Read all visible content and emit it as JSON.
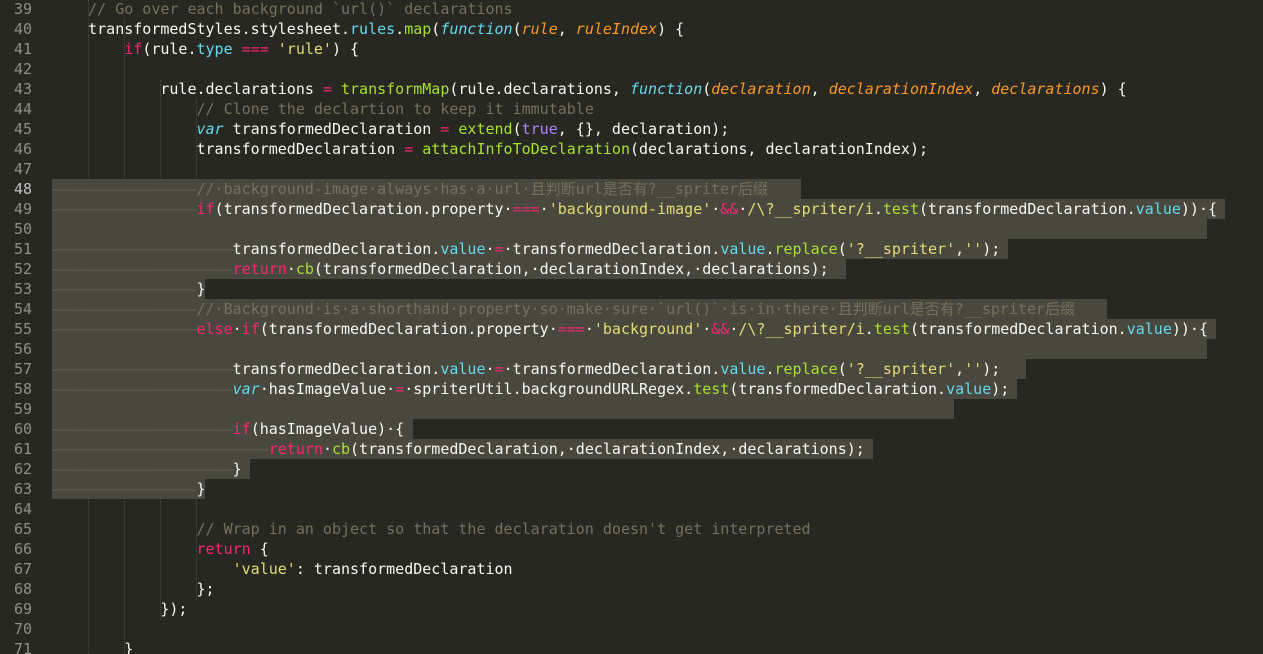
{
  "editor": {
    "theme": "monokai",
    "colors": {
      "background": "#272822",
      "selection": "#49483e",
      "keyword": "#f92672",
      "string": "#e6db74",
      "comment": "#75715e",
      "function": "#a6e22e",
      "property": "#66d9ef",
      "constant": "#ae81ff",
      "param": "#fd971f"
    },
    "line_numbers": [
      "39",
      "40",
      "41",
      "42",
      "43",
      "44",
      "45",
      "46",
      "47",
      "48",
      "49",
      "50",
      "51",
      "52",
      "53",
      "54",
      "55",
      "56",
      "57",
      "58",
      "59",
      "60",
      "61",
      "62",
      "63",
      "64",
      "65",
      "66",
      "67",
      "68",
      "69",
      "70",
      "71"
    ],
    "active_line": "48",
    "lines": [
      [
        [
          "c",
          "    // Go over each background `url()` declarations"
        ]
      ],
      [
        [
          "plain",
          "    transformedStyles.stylesheet."
        ],
        [
          "p",
          "rules"
        ],
        [
          "plain",
          "."
        ],
        [
          "f",
          "map"
        ],
        [
          "plain",
          "("
        ],
        [
          "i",
          "function"
        ],
        [
          "plain",
          "("
        ],
        [
          "t",
          "rule"
        ],
        [
          "plain",
          ", "
        ],
        [
          "t",
          "ruleIndex"
        ],
        [
          "plain",
          ") {"
        ]
      ],
      [
        [
          "plain",
          "        "
        ],
        [
          "k",
          "if"
        ],
        [
          "plain",
          "(rule."
        ],
        [
          "p",
          "type"
        ],
        [
          "plain",
          " "
        ],
        [
          "k",
          "==="
        ],
        [
          "plain",
          " "
        ],
        [
          "s",
          "'rule'"
        ],
        [
          "plain",
          ") {"
        ]
      ],
      [
        [
          "plain",
          ""
        ]
      ],
      [
        [
          "plain",
          "            rule.declarations "
        ],
        [
          "k",
          "="
        ],
        [
          "plain",
          " "
        ],
        [
          "f",
          "transformMap"
        ],
        [
          "plain",
          "(rule.declarations, "
        ],
        [
          "i",
          "function"
        ],
        [
          "plain",
          "("
        ],
        [
          "t",
          "declaration"
        ],
        [
          "plain",
          ", "
        ],
        [
          "t",
          "declarationIndex"
        ],
        [
          "plain",
          ", "
        ],
        [
          "t",
          "declarations"
        ],
        [
          "plain",
          ") {"
        ]
      ],
      [
        [
          "plain",
          "                "
        ],
        [
          "c",
          "// Clone the declartion to keep it immutable"
        ]
      ],
      [
        [
          "plain",
          "                "
        ],
        [
          "i",
          "var"
        ],
        [
          "plain",
          " transformedDeclaration "
        ],
        [
          "k",
          "="
        ],
        [
          "plain",
          " "
        ],
        [
          "f",
          "extend"
        ],
        [
          "plain",
          "("
        ],
        [
          "n",
          "true"
        ],
        [
          "plain",
          ", {}, declaration);"
        ]
      ],
      [
        [
          "plain",
          "                transformedDeclaration "
        ],
        [
          "k",
          "="
        ],
        [
          "plain",
          " "
        ],
        [
          "f",
          "attachInfoToDeclaration"
        ],
        [
          "plain",
          "(declarations, declarationIndex);"
        ]
      ],
      [
        [
          "plain",
          ""
        ]
      ],
      [
        [
          "ws",
          "————————————————"
        ],
        [
          "c",
          "//·background-image·always·has·a·url·且判断url是否有?__spriter后缀"
        ]
      ],
      [
        [
          "ws",
          "————————————————"
        ],
        [
          "k",
          "if"
        ],
        [
          "plain",
          "(transformedDeclaration.property·"
        ],
        [
          "k",
          "==="
        ],
        [
          "plain",
          "·"
        ],
        [
          "s",
          "'background-image'"
        ],
        [
          "plain",
          "·"
        ],
        [
          "k",
          "&&"
        ],
        [
          "plain",
          "·"
        ],
        [
          "s",
          "/\\?__spriter/i"
        ],
        [
          "plain",
          "."
        ],
        [
          "f",
          "test"
        ],
        [
          "plain",
          "(transformedDeclaration."
        ],
        [
          "p",
          "value"
        ],
        [
          "plain",
          "))·{"
        ]
      ],
      [
        [
          "plain",
          ""
        ]
      ],
      [
        [
          "ws",
          "————————————————————"
        ],
        [
          "plain",
          "transformedDeclaration."
        ],
        [
          "p",
          "value"
        ],
        [
          "plain",
          "·"
        ],
        [
          "k",
          "="
        ],
        [
          "plain",
          "·transformedDeclaration."
        ],
        [
          "p",
          "value"
        ],
        [
          "plain",
          "."
        ],
        [
          "f",
          "replace"
        ],
        [
          "plain",
          "("
        ],
        [
          "s",
          "'?__spriter'"
        ],
        [
          "plain",
          ","
        ],
        [
          "s",
          "''"
        ],
        [
          "plain",
          ");"
        ]
      ],
      [
        [
          "ws",
          "————————————————————"
        ],
        [
          "k",
          "return"
        ],
        [
          "plain",
          "·"
        ],
        [
          "f",
          "cb"
        ],
        [
          "plain",
          "(transformedDeclaration,·declarationIndex,·declarations);"
        ]
      ],
      [
        [
          "ws",
          "————————————————"
        ],
        [
          "plain",
          "}"
        ]
      ],
      [
        [
          "ws",
          "————————————————"
        ],
        [
          "c",
          "//·Background·is·a·shorthand·property·so·make·sure·`url()`·is·in·there·且判断url是否有?__spriter后缀"
        ]
      ],
      [
        [
          "ws",
          "————————————————"
        ],
        [
          "k",
          "else"
        ],
        [
          "plain",
          "·"
        ],
        [
          "k",
          "if"
        ],
        [
          "plain",
          "(transformedDeclaration.property·"
        ],
        [
          "k",
          "==="
        ],
        [
          "plain",
          "·"
        ],
        [
          "s",
          "'background'"
        ],
        [
          "plain",
          "·"
        ],
        [
          "k",
          "&&"
        ],
        [
          "plain",
          "·"
        ],
        [
          "s",
          "/\\?__spriter/i"
        ],
        [
          "plain",
          "."
        ],
        [
          "f",
          "test"
        ],
        [
          "plain",
          "(transformedDeclaration."
        ],
        [
          "p",
          "value"
        ],
        [
          "plain",
          "))·{"
        ]
      ],
      [
        [
          "plain",
          ""
        ]
      ],
      [
        [
          "ws",
          "————————————————————"
        ],
        [
          "plain",
          "transformedDeclaration."
        ],
        [
          "p",
          "value"
        ],
        [
          "plain",
          "·"
        ],
        [
          "k",
          "="
        ],
        [
          "plain",
          "·transformedDeclaration."
        ],
        [
          "p",
          "value"
        ],
        [
          "plain",
          "."
        ],
        [
          "f",
          "replace"
        ],
        [
          "plain",
          "("
        ],
        [
          "s",
          "'?__spriter'"
        ],
        [
          "plain",
          ","
        ],
        [
          "s",
          "''"
        ],
        [
          "plain",
          ");"
        ]
      ],
      [
        [
          "ws",
          "————————————————————"
        ],
        [
          "i",
          "var"
        ],
        [
          "plain",
          "·hasImageValue·"
        ],
        [
          "k",
          "="
        ],
        [
          "plain",
          "·spriterUtil.backgroundURLRegex."
        ],
        [
          "f",
          "test"
        ],
        [
          "plain",
          "(transformedDeclaration."
        ],
        [
          "p",
          "value"
        ],
        [
          "plain",
          ");"
        ]
      ],
      [
        [
          "plain",
          ""
        ]
      ],
      [
        [
          "ws",
          "————————————————————"
        ],
        [
          "k",
          "if"
        ],
        [
          "plain",
          "(hasImageValue)·{"
        ]
      ],
      [
        [
          "ws",
          "————————————————————————"
        ],
        [
          "k",
          "return"
        ],
        [
          "plain",
          "·"
        ],
        [
          "f",
          "cb"
        ],
        [
          "plain",
          "(transformedDeclaration,·declarationIndex,·declarations);"
        ]
      ],
      [
        [
          "ws",
          "————————————————————"
        ],
        [
          "plain",
          "}"
        ]
      ],
      [
        [
          "ws",
          "————————————————"
        ],
        [
          "plain",
          "}"
        ]
      ],
      [
        [
          "plain",
          ""
        ]
      ],
      [
        [
          "plain",
          "                "
        ],
        [
          "c",
          "// Wrap in an object so that the declaration doesn't get interpreted"
        ]
      ],
      [
        [
          "plain",
          "                "
        ],
        [
          "k",
          "return"
        ],
        [
          "plain",
          " {"
        ]
      ],
      [
        [
          "plain",
          "                    "
        ],
        [
          "s",
          "'value'"
        ],
        [
          "plain",
          ": transformedDeclaration"
        ]
      ],
      [
        [
          "plain",
          "                };"
        ]
      ],
      [
        [
          "plain",
          "            });"
        ]
      ],
      [
        [
          "plain",
          ""
        ]
      ],
      [
        [
          "plain",
          "        }"
        ]
      ]
    ]
  }
}
